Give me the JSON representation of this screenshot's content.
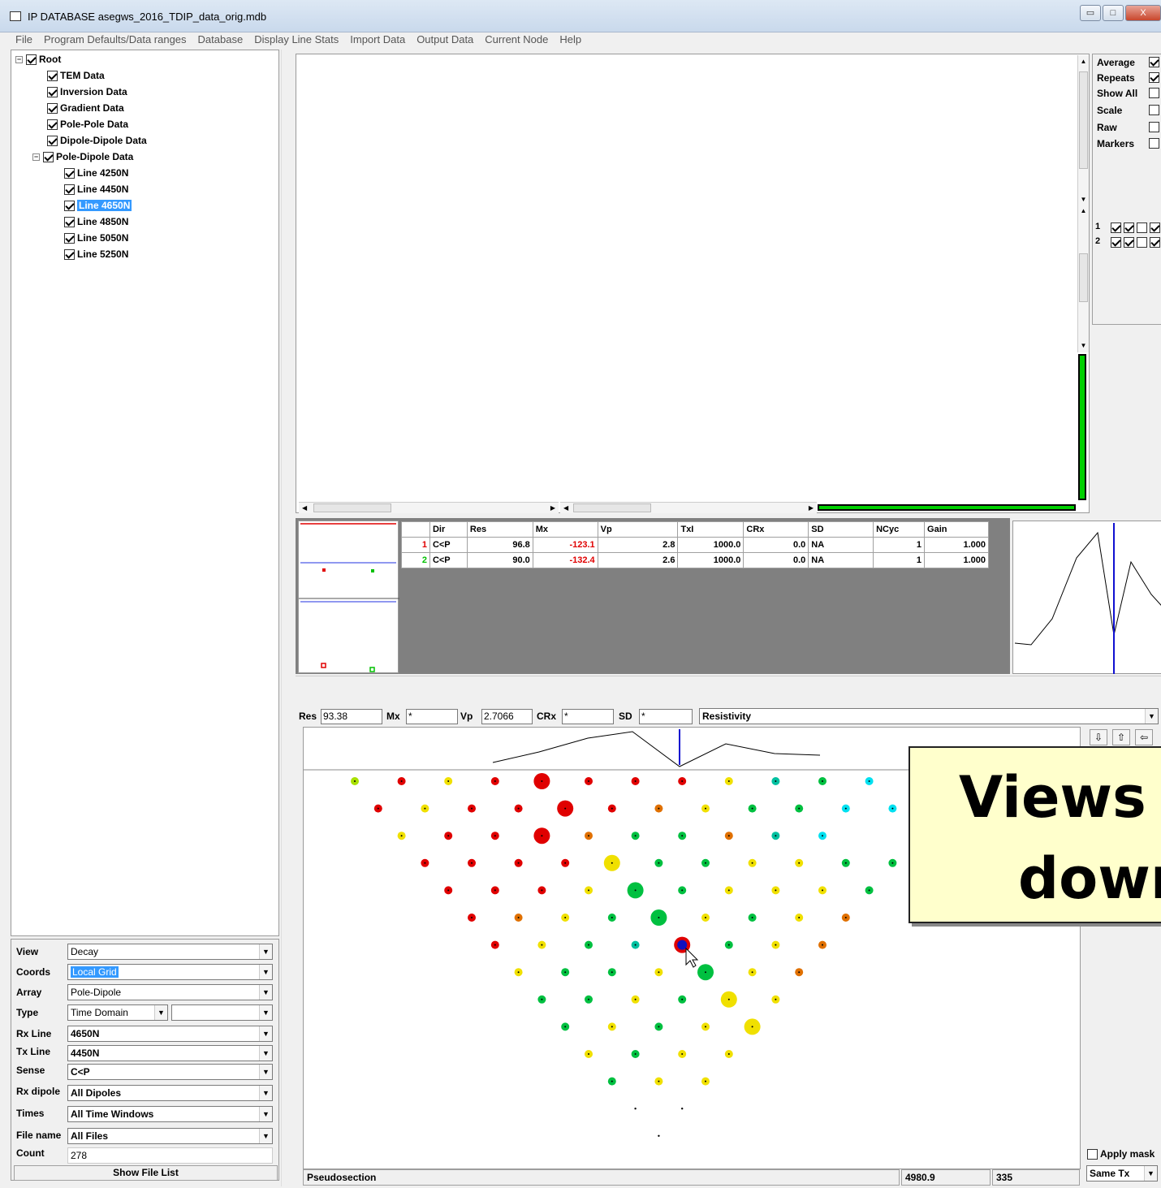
{
  "window": {
    "title": "IP DATABASE asegws_2016_TDIP_data_orig.mdb",
    "min_label": "▭",
    "max_label": "□",
    "close_label": "X"
  },
  "menu": [
    "File",
    "Program Defaults/Data ranges",
    "Database",
    "Display Line Stats",
    "Import Data",
    "Output Data",
    "Current Node",
    "Help"
  ],
  "tree": {
    "root": "Root",
    "items": [
      "TEM Data",
      "Inversion Data",
      "Gradient Data",
      "Pole-Pole Data",
      "Dipole-Dipole Data",
      "Pole-Dipole Data"
    ],
    "lines": [
      "Line 4250N",
      "Line 4450N",
      "Line 4650N",
      "Line 4850N",
      "Line 5050N",
      "Line 5250N"
    ],
    "selected_line": "Line 4650N"
  },
  "form": {
    "view": {
      "label": "View",
      "value": "Decay"
    },
    "coords": {
      "label": "Coords",
      "value": "Local Grid"
    },
    "array": {
      "label": "Array",
      "value": "Pole-Dipole"
    },
    "type": {
      "label": "Type",
      "value": "Time Domain",
      "value2": ""
    },
    "rx_line": {
      "label": "Rx Line",
      "value": "4650N"
    },
    "tx_line": {
      "label": "Tx Line",
      "value": "4450N"
    },
    "sense": {
      "label": "Sense",
      "value": "C<P"
    },
    "rx_dipole": {
      "label": "Rx dipole",
      "value": "All Dipoles"
    },
    "times": {
      "label": "Times",
      "value": "All Time Windows"
    },
    "file_name": {
      "label": "File name",
      "value": "All Files"
    },
    "count": {
      "label": "Count",
      "value": "278"
    },
    "show_file_list": "Show File List"
  },
  "options": [
    {
      "label": "Average",
      "checked": true
    },
    {
      "label": "Repeats",
      "checked": true
    },
    {
      "label": "Show All",
      "checked": false
    },
    {
      "label": "Scale",
      "checked": false
    },
    {
      "label": "Raw",
      "checked": false
    },
    {
      "label": "Markers",
      "checked": false
    }
  ],
  "series_toggles": [
    {
      "label": "1",
      "color": "#e00000"
    },
    {
      "label": "2",
      "color": "#00c000"
    }
  ],
  "table": {
    "headers": [
      "",
      "Dir",
      "Res",
      "Mx",
      "Vp",
      "TxI",
      "CRx",
      "SD",
      "NCyc",
      "Gain"
    ],
    "rows": [
      {
        "idx": "1",
        "idx_color": "#e00000",
        "Dir": "C<P",
        "Res": "96.8",
        "Mx": "-123.1",
        "Vp": "2.8",
        "TxI": "1000.0",
        "CRx": "0.0",
        "SD": "NA",
        "NCyc": "1",
        "Gain": "1.000"
      },
      {
        "idx": "2",
        "idx_color": "#00c000",
        "Dir": "C<P",
        "Res": "90.0",
        "Mx": "-132.4",
        "Vp": "2.6",
        "TxI": "1000.0",
        "CRx": "0.0",
        "SD": "NA",
        "NCyc": "1",
        "Gain": "1.000"
      }
    ]
  },
  "readout": {
    "res_label": "Res",
    "res_value": "93.38",
    "mx_label": "Mx",
    "mx_value": "*",
    "vp_label": "Vp",
    "vp_value": "2.7066",
    "crx_label": "CRx",
    "crx_value": "*",
    "sd_label": "SD",
    "sd_value": "*",
    "parameter": "Resistivity"
  },
  "status": {
    "left": "Pseudosection",
    "x": "4980.9",
    "n": "335"
  },
  "right_controls": {
    "apply_mask": "Apply mask",
    "same_tx": "Same Tx"
  },
  "callout": {
    "line1": "Views a",
    "line2": "down"
  },
  "colors": {
    "red": "#e00000",
    "orange": "#e07000",
    "yellow": "#f0e000",
    "yellowgreen": "#a8e000",
    "green": "#00c040",
    "teal": "#00c0a0",
    "cyan": "#00e0f0",
    "selection": "#3399ff"
  }
}
